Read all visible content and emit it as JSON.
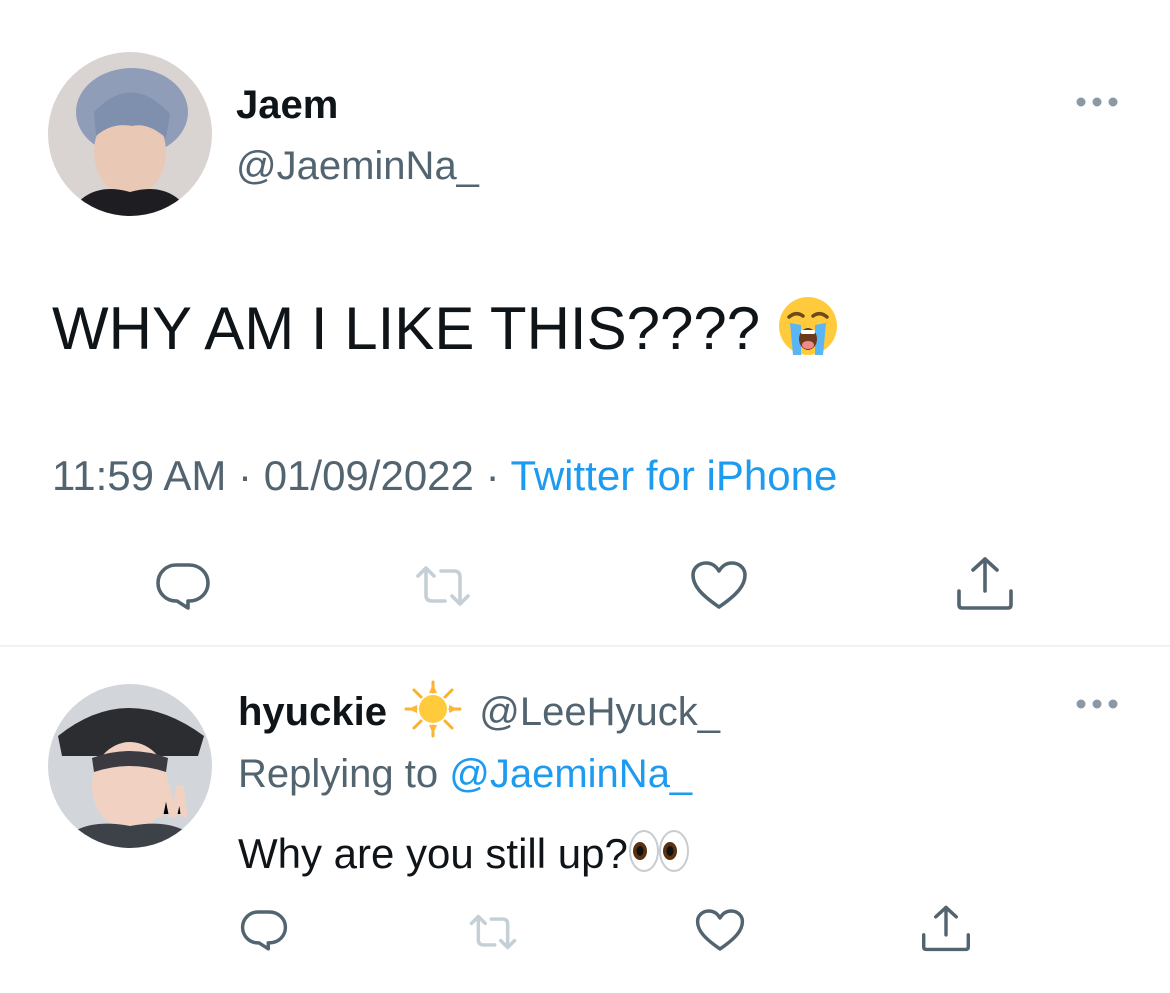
{
  "main_tweet": {
    "display_name": "Jaem",
    "handle": "@JaeminNa_",
    "text": "WHY AM I LIKE THIS????",
    "text_emoji": "loudly-crying-face-emoji",
    "time": "11:59 AM",
    "separator": "·",
    "date": "01/09/2022",
    "source": "Twitter for iPhone",
    "actions": [
      "reply-icon",
      "retweet-icon",
      "like-icon",
      "share-icon"
    ]
  },
  "reply_tweet": {
    "display_name": "hyuckie",
    "name_emoji": "sun-emoji",
    "handle": "@LeeHyuck_",
    "replying_to_label": "Replying to",
    "replying_to_handle": "@JaeminNa_",
    "text": "Why are you still up?",
    "text_emoji": "eyes-emoji",
    "actions": [
      "reply-icon",
      "retweet-icon",
      "like-icon",
      "share-icon"
    ]
  },
  "colors": {
    "link": "#1d9bf0",
    "secondary_text": "#536471",
    "icon": "#536471",
    "retweet_disabled": "#c4cfd6",
    "divider": "#eff3f4"
  }
}
